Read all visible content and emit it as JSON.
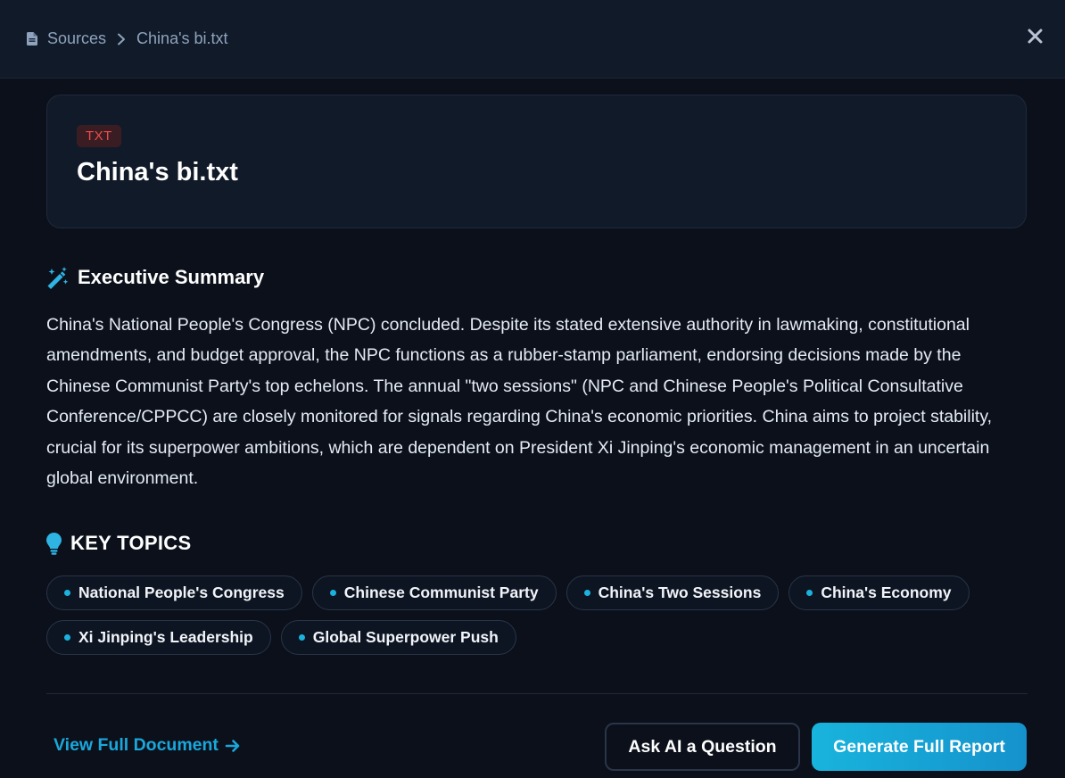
{
  "header": {
    "breadcrumb_root": "Sources",
    "breadcrumb_current": "China's bi.txt",
    "icons": {
      "root": "document-icon",
      "separator": "chevron-right-icon",
      "close": "close-icon"
    }
  },
  "file": {
    "badge": "TXT",
    "title": "China's bi.txt"
  },
  "summary": {
    "heading": "Executive Summary",
    "icon": "magic-wand-icon",
    "text": "China's National People's Congress (NPC) concluded. Despite its stated extensive authority in lawmaking, constitutional amendments, and budget approval, the NPC functions as a rubber-stamp parliament, endorsing decisions made by the Chinese Communist Party's top echelons. The annual \"two sessions\" (NPC and Chinese People's Political Consultative Conference/CPPCC) are closely monitored for signals regarding China's economic priorities. China aims to project stability, crucial for its superpower ambitions, which are dependent on President Xi Jinping's economic management in an uncertain global environment."
  },
  "topics": {
    "heading": "KEY TOPICS",
    "icon": "lightbulb-icon",
    "items": [
      "National People's Congress",
      "Chinese Communist Party",
      "China's Two Sessions",
      "China's Economy",
      "Xi Jinping's Leadership",
      "Global Superpower Push"
    ]
  },
  "footer": {
    "view_link": "View Full Document",
    "ask_button": "Ask AI a Question",
    "generate_button": "Generate Full Report"
  },
  "colors": {
    "background": "#0b101b",
    "card": "#111a29",
    "accent": "#1aa8dc",
    "badge_text": "#ef4b4b",
    "badge_bg": "#3a1d22"
  }
}
